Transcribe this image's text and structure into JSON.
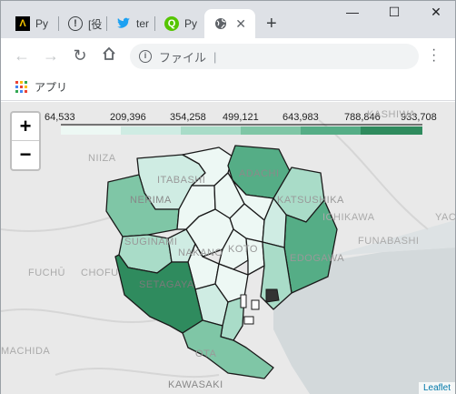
{
  "tabs": [
    {
      "icon": "app-logo-icon",
      "label": "Py"
    },
    {
      "icon": "info-circle-icon",
      "label": "[役"
    },
    {
      "icon": "twitter-icon",
      "label": "ter"
    },
    {
      "icon": "qiita-icon",
      "label": "Py"
    },
    {
      "icon": "globe-icon",
      "label": ""
    }
  ],
  "toolbar": {
    "address_prefix": "ファイル"
  },
  "bookmarks": {
    "apps_label": "アプリ"
  },
  "map": {
    "legend_ticks": [
      "64,533",
      "209,396",
      "354,258",
      "499,121",
      "643,983",
      "788,846",
      "933,708"
    ],
    "legend_colors": [
      "#edf8f4",
      "#cfece3",
      "#a9dcc8",
      "#7fc6a6",
      "#55ad86",
      "#2f8b5e"
    ],
    "zoom_in": "+",
    "zoom_out": "−",
    "attribution": "Leaflet",
    "place_labels": [
      "KASHIWA",
      "NIIZA",
      "ADACHI",
      "ITABASHI",
      "NERIMA",
      "KATSUSHIKA",
      "ICHIKAWA",
      "YACHI",
      "SUGINAMI",
      "NAKANO",
      "FUNABASHI",
      "EDOGAWA",
      "FUCHŪ",
      "CHOFU",
      "SETAGAYA",
      "KOTO",
      "MACHIDA",
      "OTA",
      "KAWASAKI"
    ]
  },
  "colors": {
    "boundary": "#1a1a1a",
    "water": "#d4dadc"
  }
}
